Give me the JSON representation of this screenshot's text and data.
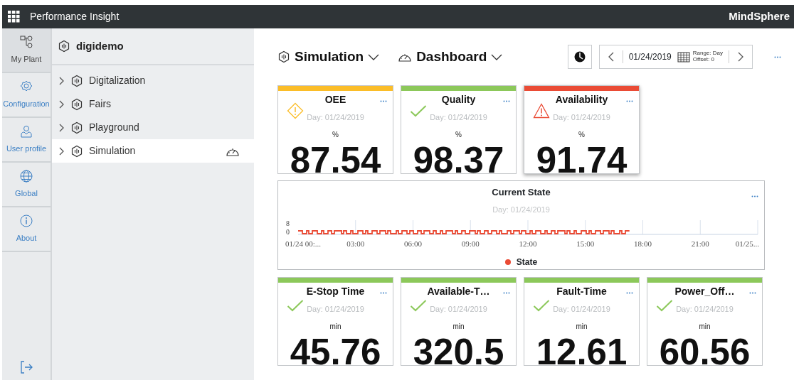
{
  "header": {
    "title": "Performance Insight",
    "brand": "MindSphere"
  },
  "nav": [
    {
      "label": "My Plant",
      "selected": true
    },
    {
      "label": "Configuration",
      "selected": false
    },
    {
      "label": "User profile",
      "selected": false
    },
    {
      "label": "Global",
      "selected": false
    },
    {
      "label": "About",
      "selected": false
    }
  ],
  "tree": {
    "root": "digidemo",
    "items": [
      {
        "label": "Digitalization",
        "selected": false
      },
      {
        "label": "Fairs",
        "selected": false
      },
      {
        "label": "Playground",
        "selected": false
      },
      {
        "label": "Simulation",
        "selected": true
      }
    ]
  },
  "toolbar": {
    "asset": "Simulation",
    "view": "Dashboard",
    "date": "01/24/2019",
    "range": "Range: Day",
    "offset": "Offset: 0"
  },
  "kpis_top": [
    {
      "title": "OEE",
      "date": "Day: 01/24/2019",
      "unit": "%",
      "value": "87.54",
      "kind": "warning",
      "color": "#fbbd28"
    },
    {
      "title": "Quality",
      "date": "Day: 01/24/2019",
      "unit": "%",
      "value": "98.37",
      "kind": "ok",
      "color": "#8cc85a"
    },
    {
      "title": "Availability",
      "date": "Day: 01/24/2019",
      "unit": "%",
      "value": "91.74",
      "kind": "error",
      "color": "#ea4b35"
    }
  ],
  "chart": {
    "title": "Current State",
    "subtitle": "Day: 01/24/2019",
    "y_labels": [
      "8",
      "0"
    ],
    "x_labels": [
      "01/24 00:...",
      "03:00",
      "06:00",
      "09:00",
      "12:00",
      "15:00",
      "18:00",
      "21:00",
      "01/25..."
    ],
    "legend": [
      {
        "label": "State",
        "color": "#ea4b35"
      }
    ]
  },
  "kpis_bottom": [
    {
      "title": "E-Stop Time",
      "date": "Day: 01/24/2019",
      "unit": "min",
      "value": "45.76",
      "kind": "ok",
      "color": "#8cc85a"
    },
    {
      "title": "Available-T…",
      "date": "Day: 01/24/2019",
      "unit": "min",
      "value": "320.5",
      "kind": "ok",
      "color": "#8cc85a"
    },
    {
      "title": "Fault-Time",
      "date": "Day: 01/24/2019",
      "unit": "min",
      "value": "12.61",
      "kind": "ok",
      "color": "#8cc85a"
    },
    {
      "title": "Power_Off…",
      "date": "Day: 01/24/2019",
      "unit": "min",
      "value": "60.56",
      "kind": "ok",
      "color": "#8cc85a"
    }
  ]
}
